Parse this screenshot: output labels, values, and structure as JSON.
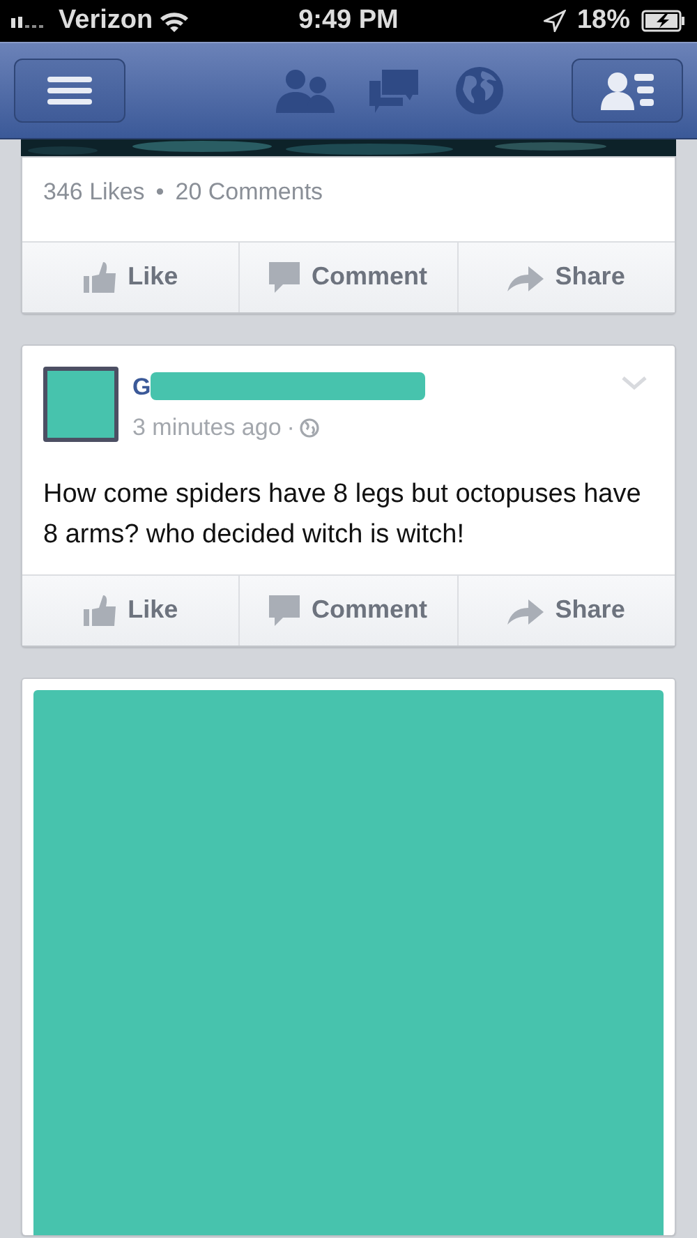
{
  "status_bar": {
    "carrier": "Verizon",
    "time": "9:49 PM",
    "battery": "18%"
  },
  "posts": [
    {
      "kind": "stats",
      "likes": "346 Likes",
      "separator": "•",
      "comments": "20 Comments",
      "actions": [
        "Like",
        "Comment",
        "Share"
      ]
    },
    {
      "kind": "status",
      "author": "G",
      "time": "3 minutes ago",
      "dot": "·",
      "text": "How come spiders have 8 legs but octopuses have 8 arms? who decided witch is witch!",
      "actions": [
        "Like",
        "Comment",
        "Share"
      ]
    },
    {
      "kind": "redacted"
    }
  ]
}
